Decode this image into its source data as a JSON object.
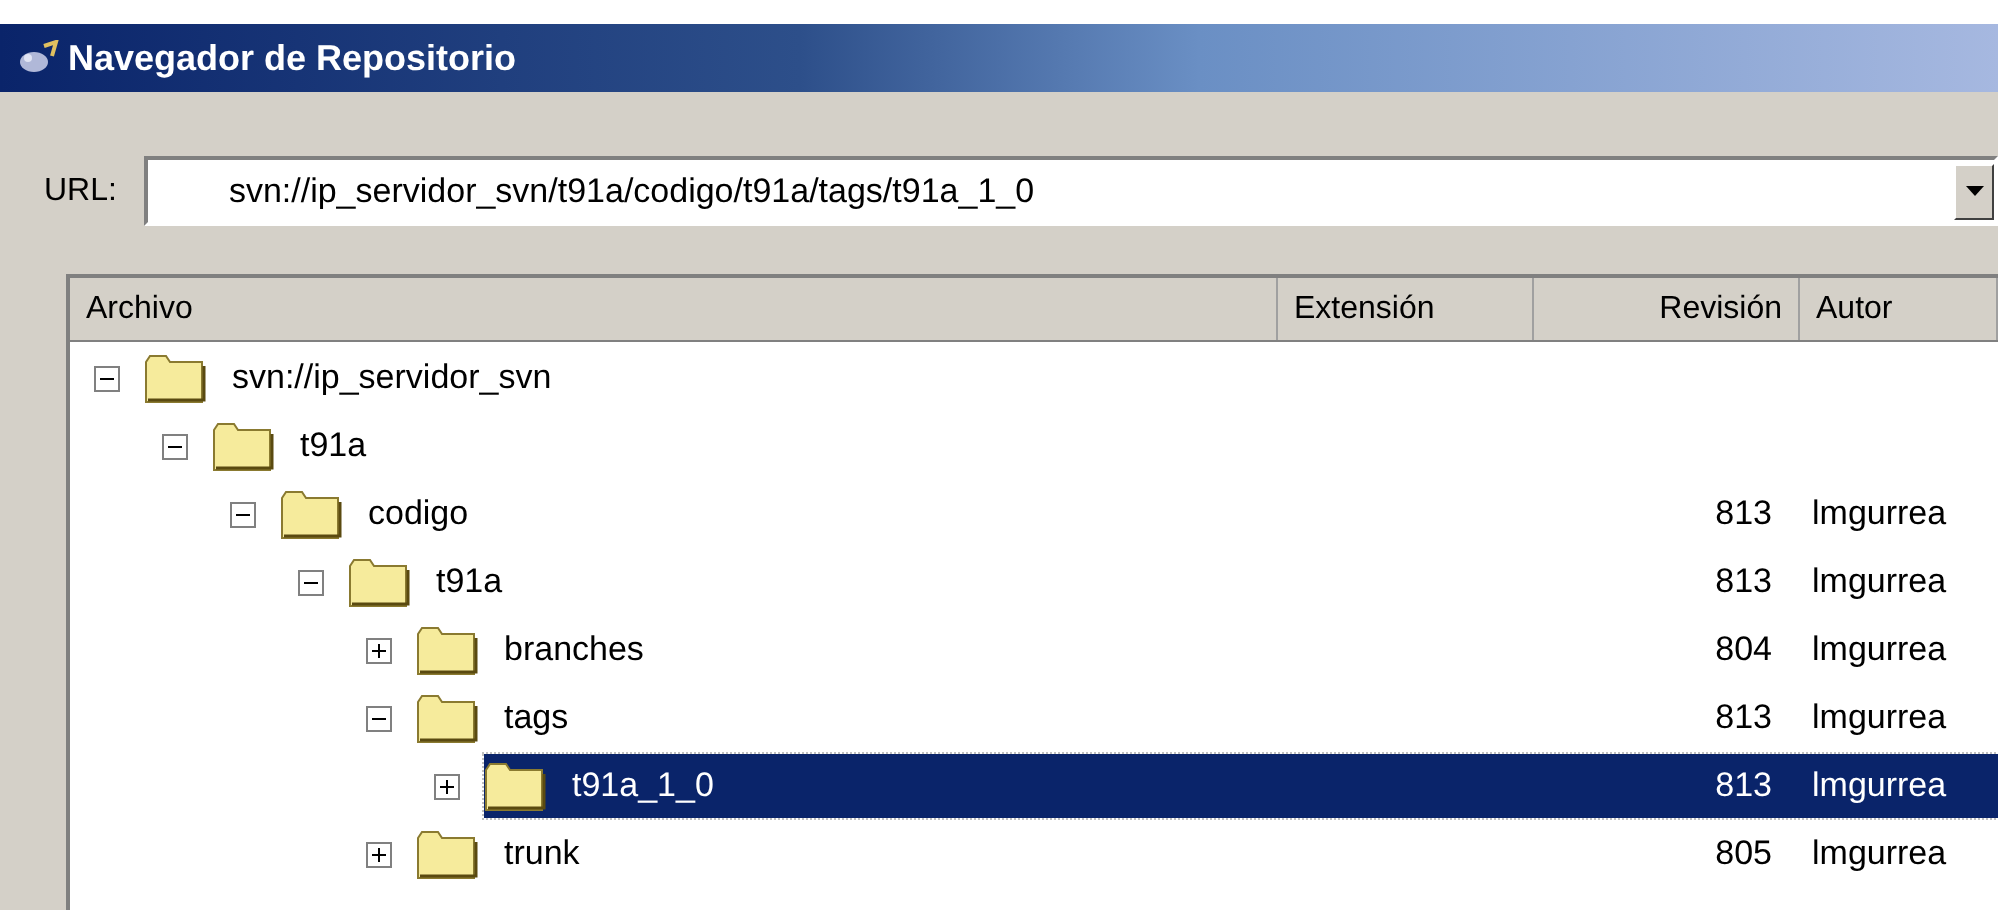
{
  "window": {
    "title": "Navegador de Repositorio"
  },
  "url": {
    "label": "URL:",
    "value": "svn://ip_servidor_svn/t91a/codigo/t91a/tags/t91a_1_0"
  },
  "table": {
    "columns": [
      "Archivo",
      "Extensión",
      "Revisión",
      "Autor"
    ],
    "tree": [
      {
        "name": "svn://ip_servidor_svn",
        "expanded": true,
        "selected": false,
        "children": [
          {
            "name": "t91a",
            "expanded": true,
            "selected": false,
            "children": [
              {
                "name": "codigo",
                "revision": "813",
                "author": "lmgurrea",
                "expanded": true,
                "selected": false,
                "children": [
                  {
                    "name": "t91a",
                    "revision": "813",
                    "author": "lmgurrea",
                    "expanded": true,
                    "selected": false,
                    "children": [
                      {
                        "name": "branches",
                        "revision": "804",
                        "author": "lmgurrea",
                        "expanded": false,
                        "selected": false
                      },
                      {
                        "name": "tags",
                        "revision": "813",
                        "author": "lmgurrea",
                        "expanded": true,
                        "selected": false,
                        "children": [
                          {
                            "name": "t91a_1_0",
                            "revision": "813",
                            "author": "lmgurrea",
                            "expanded": false,
                            "selected": true
                          }
                        ]
                      },
                      {
                        "name": "trunk",
                        "revision": "805",
                        "author": "lmgurrea",
                        "expanded": false,
                        "selected": false
                      }
                    ]
                  }
                ]
              }
            ]
          }
        ]
      }
    ]
  }
}
